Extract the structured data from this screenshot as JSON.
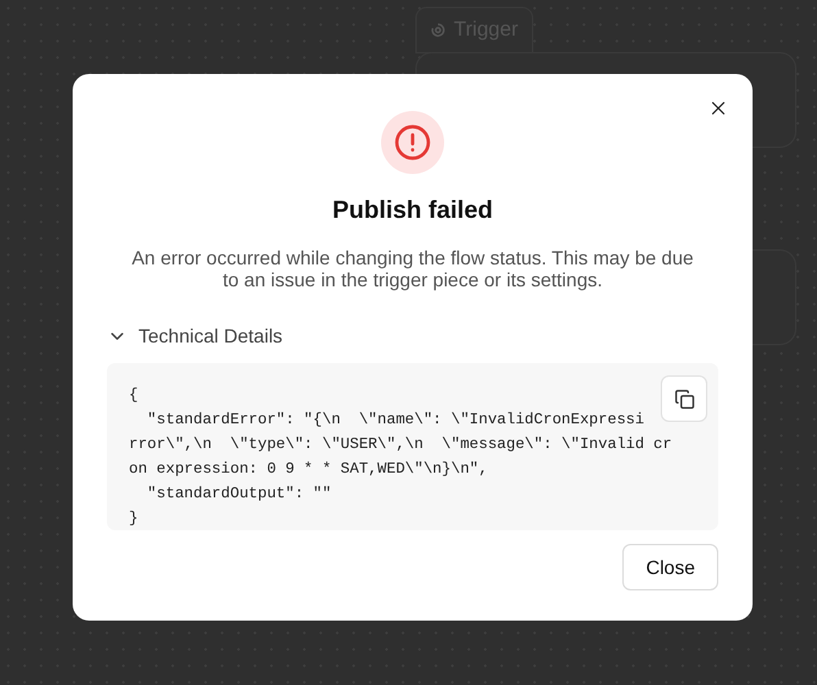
{
  "canvas": {
    "trigger_tab": "Trigger"
  },
  "dialog": {
    "title": "Publish failed",
    "message": "An error occurred while changing the flow status. This may be due to an issue in the trigger piece or its settings.",
    "details": {
      "label": "Technical Details",
      "expanded": true,
      "code_lines": [
        "{",
        "  \"standardError\": \"{\\n  \\\"name\\\": \\\"InvalidCronExpressi",
        "rror\\\",\\n  \\\"type\\\": \\\"USER\\\",\\n  \\\"message\\\": \\\"Invalid cr",
        "on expression: 0 9 * * SAT,WED\\\"\\n}\\n\",",
        "  \"standardOutput\": \"\"",
        "}"
      ]
    },
    "buttons": [
      "Close"
    ]
  }
}
